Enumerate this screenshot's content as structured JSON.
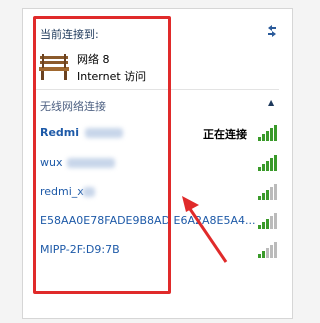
{
  "connected": {
    "label": "当前连接到:",
    "network_name": "网络  8",
    "access_text": "Internet 访问"
  },
  "wireless": {
    "header": "无线网络连接",
    "networks": [
      {
        "name": "Redmi",
        "status": "正在连接",
        "bold": true
      },
      {
        "name": "wux",
        "status": "",
        "bold": false
      },
      {
        "name": "redmi_x",
        "status": "",
        "bold": false
      },
      {
        "name": "E58AA0E78FADE9B8AD E6A2A8E5A4...",
        "status": "",
        "bold": false
      },
      {
        "name": "MIPP-2F:D9:7B",
        "status": "",
        "bold": false
      }
    ]
  },
  "colors": {
    "accent_text": "#1e5aa8",
    "signal_green": "#3a9a2a",
    "highlight_red": "#e02a2a"
  },
  "icons": {
    "refresh": "refresh-icon",
    "bench": "bench-icon",
    "collapse": "chevron-up-icon",
    "signal": "wifi-signal-icon"
  }
}
